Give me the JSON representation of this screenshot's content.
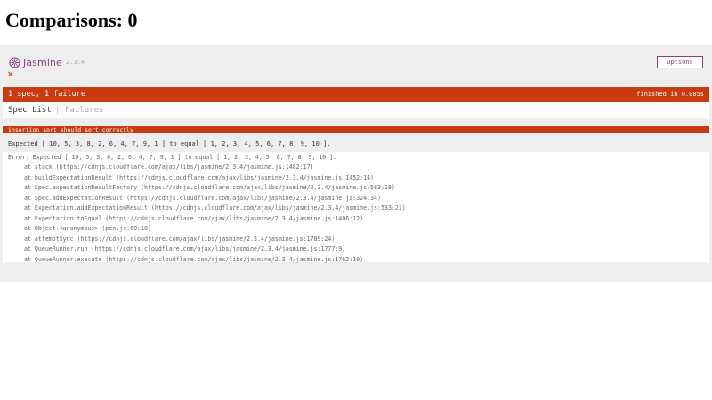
{
  "page": {
    "title": "Comparisons: 0"
  },
  "jasmine": {
    "logo_text": "Jasmine",
    "version": "2.3.4",
    "options_label": "Options",
    "fail_marker": "×",
    "summary": "1 spec, 1 failure",
    "duration": "finished in 0.005s",
    "nav": {
      "spec_list": "Spec List",
      "separator": "|",
      "failures": "Failures"
    },
    "spec_title": "insertion sort should sort correctly",
    "expected_message": "Expected [ 10, 5, 3, 8, 2, 6, 4, 7, 9, 1 ] to equal [ 1, 2, 3, 4, 5, 6, 7, 8, 9, 10 ].",
    "stack": {
      "error": "Error: Expected [ 10, 5, 3, 8, 2, 6, 4, 7, 9, 1 ] to equal [ 1, 2, 3, 4, 5, 6, 7, 8, 9, 10 ].",
      "frames": [
        "at stack (https://cdnjs.cloudflare.com/ajax/libs/jasmine/2.3.4/jasmine.js:1482:17)",
        "at buildExpectationResult (https://cdnjs.cloudflare.com/ajax/libs/jasmine/2.3.4/jasmine.js:1452:14)",
        "at Spec.expectationResultFactory (https://cdnjs.cloudflare.com/ajax/libs/jasmine/2.3.4/jasmine.js:583:18)",
        "at Spec.addExpectationResult (https://cdnjs.cloudflare.com/ajax/libs/jasmine/2.3.4/jasmine.js:324:34)",
        "at Expectation.addExpectationResult (https://cdnjs.cloudflare.com/ajax/libs/jasmine/2.3.4/jasmine.js:533:21)",
        "at Expectation.toEqual (https://cdnjs.cloudflare.com/ajax/libs/jasmine/2.3.4/jasmine.js:1406:12)",
        "at Object.<anonymous> (pen.js:60:18)",
        "at attemptSync (https://cdnjs.cloudflare.com/ajax/libs/jasmine/2.3.4/jasmine.js:1789:24)",
        "at QueueRunner.run (https://cdnjs.cloudflare.com/ajax/libs/jasmine/2.3.4/jasmine.js:1777:9)",
        "at QueueRunner.execute (https://cdnjs.cloudflare.com/ajax/libs/jasmine/2.3.4/jasmine.js:1762:10)"
      ]
    },
    "colors": {
      "failure": "#ca3a11",
      "brand": "#8a4182",
      "panel_background": "#eeeeee"
    },
    "icons": {
      "logo": "jasmine-flower-icon",
      "fail": "close-icon"
    }
  }
}
